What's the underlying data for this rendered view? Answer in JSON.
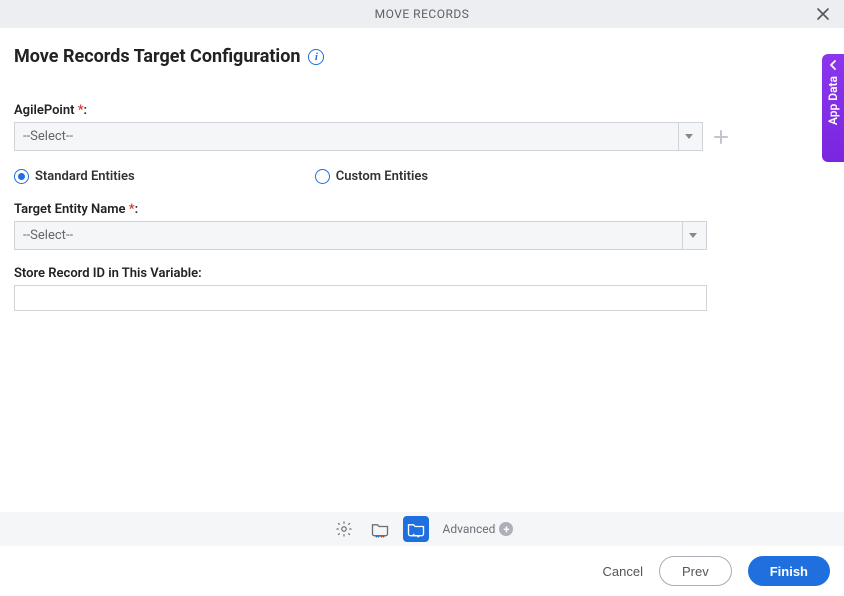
{
  "titlebar": {
    "title": "MOVE RECORDS"
  },
  "heading": "Move Records Target Configuration",
  "form": {
    "agilepoint": {
      "label": "AgilePoint",
      "required_mark": "*",
      "colon": ":",
      "selected": "--Select--"
    },
    "entity_type": {
      "options": [
        {
          "label": "Standard Entities",
          "selected": true
        },
        {
          "label": "Custom Entities",
          "selected": false
        }
      ]
    },
    "target_entity": {
      "label": "Target Entity Name",
      "required_mark": "*",
      "colon": ":",
      "selected": "--Select--"
    },
    "store_variable": {
      "label": "Store Record ID in This Variable:",
      "value": ""
    }
  },
  "side_panel": {
    "label": "App Data"
  },
  "toolbar": {
    "advanced_label": "Advanced"
  },
  "footer": {
    "cancel": "Cancel",
    "prev": "Prev",
    "finish": "Finish"
  }
}
